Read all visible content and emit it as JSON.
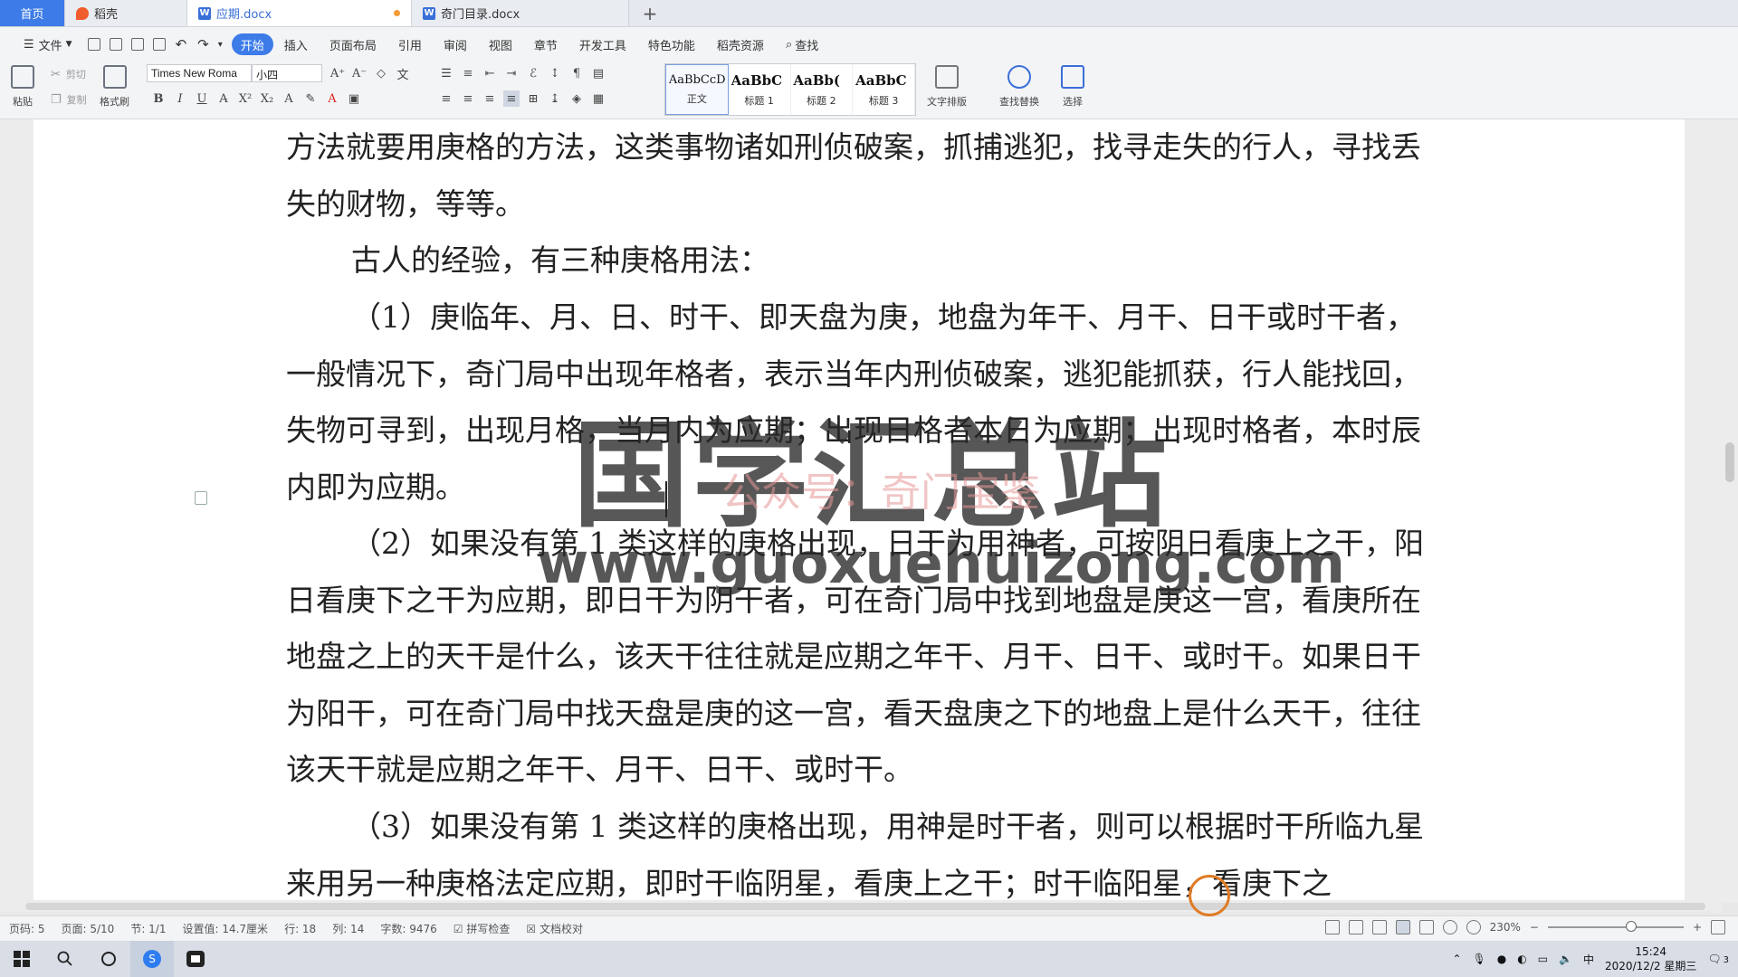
{
  "tabs": {
    "home": "首页",
    "docer": "稻壳",
    "active_doc": "应期.docx",
    "other_doc": "奇门目录.docx",
    "new_tab": "+"
  },
  "menu": {
    "file": "文件",
    "items": [
      "开始",
      "插入",
      "页面布局",
      "引用",
      "审阅",
      "视图",
      "章节",
      "开发工具",
      "特色功能",
      "稻壳资源"
    ],
    "search": "查找"
  },
  "ribbon": {
    "paste": "粘贴",
    "cut": "剪切",
    "copy": "复制",
    "format_painter": "格式刷",
    "font_name": "Times New Roma",
    "font_size": "小四",
    "styles": [
      {
        "preview": "AaBbCcD",
        "label": "正文"
      },
      {
        "preview": "AaBbC",
        "label": "标题 1"
      },
      {
        "preview": "AaBb(",
        "label": "标题 2"
      },
      {
        "preview": "AaBbC",
        "label": "标题 3"
      }
    ],
    "text_layout": "文字排版",
    "find_replace": "查找替换",
    "select": "选择"
  },
  "document": {
    "paragraphs": [
      "方法就要用庚格的方法，这类事物诸如刑侦破案，抓捕逃犯，找寻走失的行人，寻找丢失的财物，等等。",
      "古人的经验，有三种庚格用法：",
      "（1）庚临年、月、日、时干、即天盘为庚，地盘为年干、月干、日干或时干者，一般情况下，奇门局中出现年格者，表示当年内刑侦破案，逃犯能抓获，行人能找回，失物可寻到，出现月格，当月内为应期；出现日格者本日为应期；出现时格者，本时辰内即为应期。",
      "（2）如果没有第 1 类这样的庚格出现，日干为用神者，可按阴日看庚上之干，阳日看庚下之干为应期，即日干为阴干者，可在奇门局中找到地盘是庚这一宫，看庚所在地盘之上的天干是什么，该天干往往就是应期之年干、月干、日干、或时干。如果日干为阳干，可在奇门局中找天盘是庚的这一宫，看天盘庚之下的地盘上是什么天干，往往该天干就是应期之年干、月干、日干、或时干。",
      "（3）如果没有第 1 类这样的庚格出现，用神是时干者，则可以根据时干所临九星来用另一种庚格法定应期，即时干临阴星，看庚上之干；时干临阳星，看庚下之"
    ],
    "watermark_title": "国学汇总站",
    "watermark_sub": "公众号：奇门宝鉴",
    "watermark_url": "www.guoxuehuizong.com"
  },
  "status": {
    "page_num": "页码: 5",
    "pages": "页面: 5/10",
    "section": "节: 1/1",
    "settings": "设置值: 14.7厘米",
    "row": "行: 18",
    "col": "列: 14",
    "word_count": "字数: 9476",
    "spell_check": "拼写检查",
    "doc_proof": "文档校对",
    "zoom": "230%"
  },
  "taskbar": {
    "time": "15:24",
    "date": "2020/12/2 星期三",
    "ime": "中",
    "notifications": "3"
  }
}
